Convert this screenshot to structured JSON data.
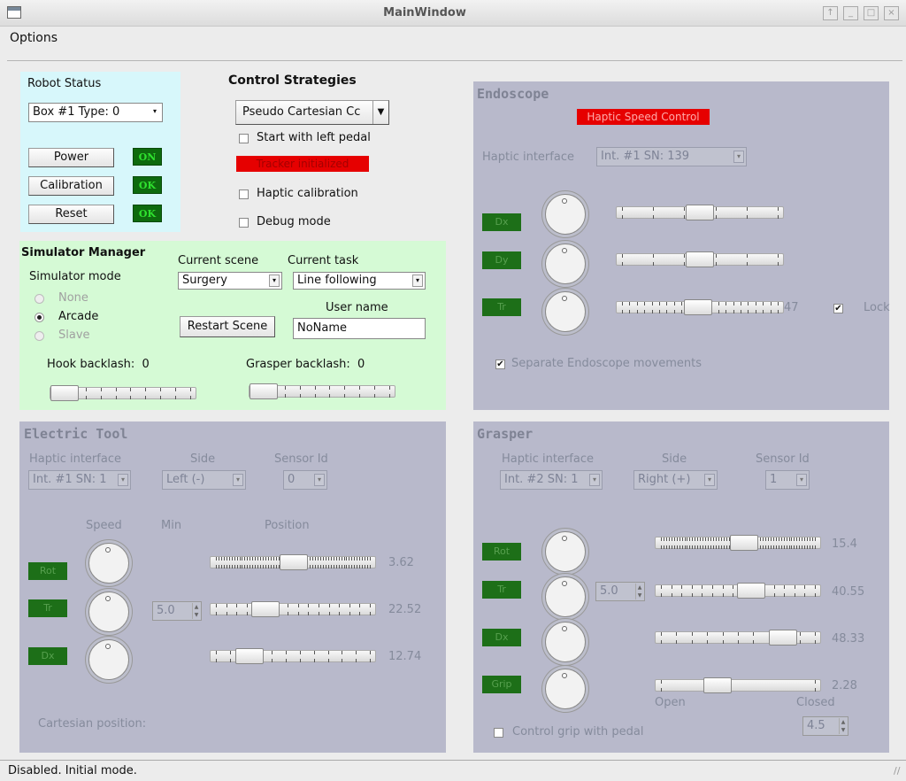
{
  "window": {
    "title": "MainWindow"
  },
  "menu": {
    "options": "Options"
  },
  "robot_status": {
    "title": "Robot Status",
    "box_combo": "Box #1  Type: 0",
    "power": "Power",
    "power_state": "ON",
    "calibration": "Calibration",
    "calibration_state": "OK",
    "reset": "Reset",
    "reset_state": "OK"
  },
  "control": {
    "title": "Control Strategies",
    "strategy": "Pseudo Cartesian Cc",
    "start_left_pedal": "Start with left pedal",
    "tracker": "Tracker initialized",
    "haptic_calibration": "Haptic calibration",
    "debug_mode": "Debug mode"
  },
  "simulator": {
    "title": "Simulator Manager",
    "mode_label": "Simulator mode",
    "modes": [
      "None",
      "Arcade",
      "Slave"
    ],
    "selected_mode": "Arcade",
    "scene_label": "Current scene",
    "scene": "Surgery",
    "task_label": "Current task",
    "task": "Line following",
    "restart": "Restart Scene",
    "user_label": "User name",
    "user": "NoName",
    "hook_label": "Hook backlash:",
    "hook_value": "0",
    "grasper_label": "Grasper backlash:",
    "grasper_value": "0"
  },
  "endoscope": {
    "title": "Endoscope",
    "haptic_speed": "Haptic Speed Control",
    "haptic_label": "Haptic interface",
    "haptic_combo": "Int. #1  SN: 139",
    "axes": [
      "Dx",
      "Dy",
      "Tr"
    ],
    "tr_value": "47",
    "lock": "Lock",
    "separate": "Separate Endoscope movements"
  },
  "electric": {
    "title": "Electric Tool",
    "haptic_label": "Haptic interface",
    "haptic_combo": "Int. #1  SN: 1",
    "side_label": "Side",
    "side_combo": "Left (-)",
    "sensor_label": "Sensor Id",
    "sensor_combo": "0",
    "speed_label": "Speed",
    "min_label": "Min",
    "position_label": "Position",
    "axes": [
      "Rot",
      "Tr",
      "Dx"
    ],
    "values": [
      "3.62",
      "22.52",
      "12.74"
    ],
    "min_value": "5.0",
    "cartesian": "Cartesian position:"
  },
  "grasper": {
    "title": "Grasper",
    "haptic_label": "Haptic interface",
    "haptic_combo": "Int. #2  SN: 1",
    "side_label": "Side",
    "side_combo": "Right (+)",
    "sensor_label": "Sensor Id",
    "sensor_combo": "1",
    "axes": [
      "Rot",
      "Tr",
      "Dx",
      "Grip"
    ],
    "values": [
      "15.4",
      "40.55",
      "48.33",
      "2.28"
    ],
    "min_value": "5.0",
    "open": "Open",
    "closed": "Closed",
    "grip_pedal": "Control grip with pedal",
    "grip_value": "4.5"
  },
  "status": {
    "text": "Disabled. Initial mode."
  },
  "colors": {
    "robot_bg": "#d7f7fb",
    "sim_bg": "#d5fad5",
    "tool_bg": "#b8b9cb",
    "red": "#e10000",
    "green_ind": "#1e6e1e"
  }
}
